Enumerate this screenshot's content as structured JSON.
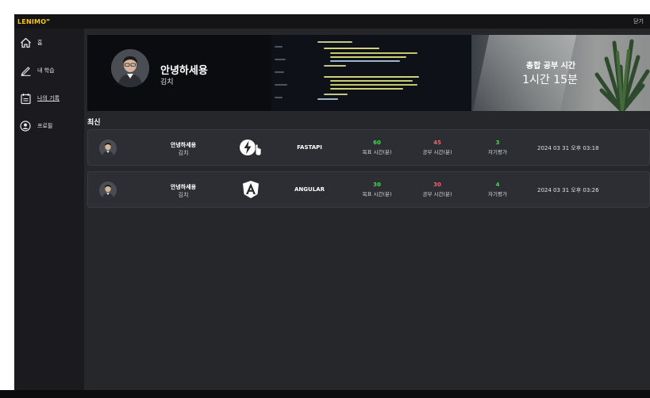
{
  "app": {
    "logo": "LENIMO",
    "close_label": "닫기"
  },
  "sidebar": {
    "items": [
      {
        "label": "홈",
        "icon": "home-icon"
      },
      {
        "label": "내 학습",
        "icon": "pencil-icon"
      },
      {
        "label": "나의 기록",
        "icon": "calendar-icon",
        "active": true
      },
      {
        "label": "프로필",
        "icon": "user-circle-icon"
      }
    ]
  },
  "banner": {
    "greeting": "안녕하세용",
    "name": "김치",
    "total_label": "총합 공부 시간",
    "total_value": "1시간 15분"
  },
  "section_title": "최신",
  "colors": {
    "goal": "#3ddc4e",
    "study": "#f2646e",
    "rating": "#3ddc4e",
    "logo": "#f5c518"
  },
  "records": [
    {
      "greeting": "안녕하세용",
      "name": "김치",
      "icon": "fastapi-bolt-icon",
      "subject": "FASTAPI",
      "goal": "60",
      "goal_label": "목표 시간(분)",
      "study": "45",
      "study_label": "공부 시간(분)",
      "rating": "3",
      "rating_label": "자기평가",
      "date": "2024 03 31 오후 03:18"
    },
    {
      "greeting": "안녕하세용",
      "name": "김치",
      "icon": "angular-icon",
      "subject": "ANGULAR",
      "goal": "30",
      "goal_label": "목표 시간(분)",
      "study": "30",
      "study_label": "공부 시간(분)",
      "rating": "4",
      "rating_label": "자기평가",
      "date": "2024 03 31 오후 03:26"
    }
  ]
}
